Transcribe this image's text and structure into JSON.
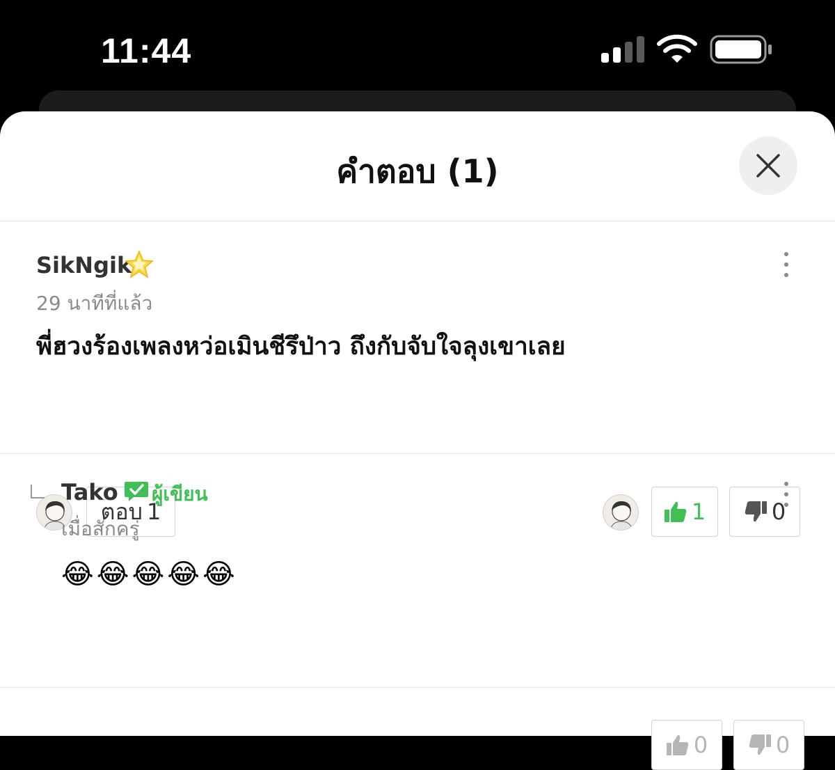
{
  "status_bar": {
    "time": "11:44",
    "signal_icon": "cellular-signal-icon",
    "wifi_icon": "wifi-icon",
    "battery_icon": "battery-icon"
  },
  "sheet": {
    "title": "คำตอบ (1)",
    "close_icon": "close-icon"
  },
  "comment": {
    "username": "SikNgik",
    "badge_icon": "star-icon",
    "timestamp": "29 นาทีที่แล้ว",
    "text": "พี่ฮวงร้องเพลงหว่อเมินชีรึป่าว ถึงกับจับใจลุงเขาเลย",
    "reply_label": "ตอบ",
    "reply_count": "1",
    "like_count": "1",
    "dislike_count": "0",
    "like_color": "#3fbf55"
  },
  "reply": {
    "username": "Tako",
    "author_label": "ผู้เขียน",
    "timestamp": "เมื่อสักครู่",
    "text": "😂😂😂😂😂",
    "like_count": "0",
    "dislike_count": "0"
  }
}
